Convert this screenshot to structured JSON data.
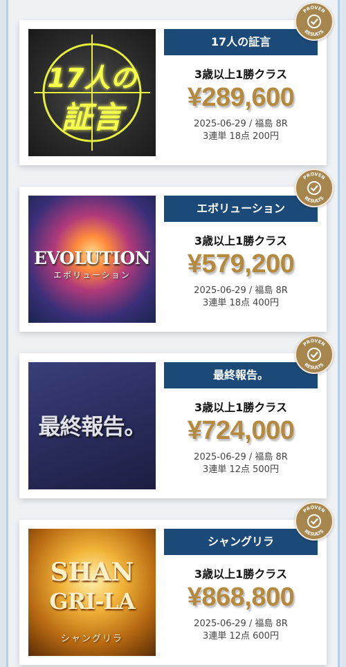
{
  "colors": {
    "name_bar": "#1c4a78",
    "payout": "#b38a3f",
    "badge": "#a7864e"
  },
  "badge": {
    "top_text": "PROVEN",
    "bottom_text": "RESULTS",
    "icon": "check-circle-icon"
  },
  "items": [
    {
      "name": "17人の証言",
      "class_label": "3歳以上1勝クラス",
      "payout": "¥289,600",
      "race": "2025-06-29 / 福島 8R",
      "bet": "3連単 18点 200円",
      "thumb_lines": [
        "17人の",
        "証言"
      ]
    },
    {
      "name": "エボリューション",
      "class_label": "3歳以上1勝クラス",
      "payout": "¥579,200",
      "race": "2025-06-29 / 福島 8R",
      "bet": "3連単 18点 400円",
      "thumb_lines": [
        "EVOLUTION",
        "エボリューション"
      ]
    },
    {
      "name": "最終報告。",
      "class_label": "3歳以上1勝クラス",
      "payout": "¥724,000",
      "race": "2025-06-29 / 福島 8R",
      "bet": "3連単 12点 500円",
      "thumb_lines": [
        "最終報告。"
      ]
    },
    {
      "name": "シャングリラ",
      "class_label": "3歳以上1勝クラス",
      "payout": "¥868,800",
      "race": "2025-06-29 / 福島 8R",
      "bet": "3連単 12点 600円",
      "thumb_lines": [
        "SHAN",
        "GRI-LA",
        "シャングリラ"
      ]
    }
  ]
}
